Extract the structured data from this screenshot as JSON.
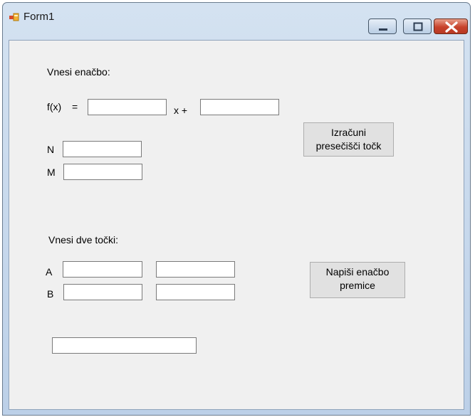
{
  "window": {
    "title": "Form1"
  },
  "form": {
    "equation_label": "Vnesi enačbo:",
    "fx_label": "f(x)",
    "equals_label": "=",
    "x_plus_label": "x  +",
    "n_label": "N",
    "m_label": "M",
    "points_label": "Vnesi dve točki:",
    "a_label": "A",
    "b_label": "B",
    "intersect_button": "Izračuni\npresečišči točk",
    "line_button": "Napiši enačbo\npremice",
    "fields": {
      "slope": "",
      "intercept": "",
      "n": "",
      "m": "",
      "a_x": "",
      "a_y": "",
      "b_x": "",
      "b_y": "",
      "result": ""
    }
  }
}
